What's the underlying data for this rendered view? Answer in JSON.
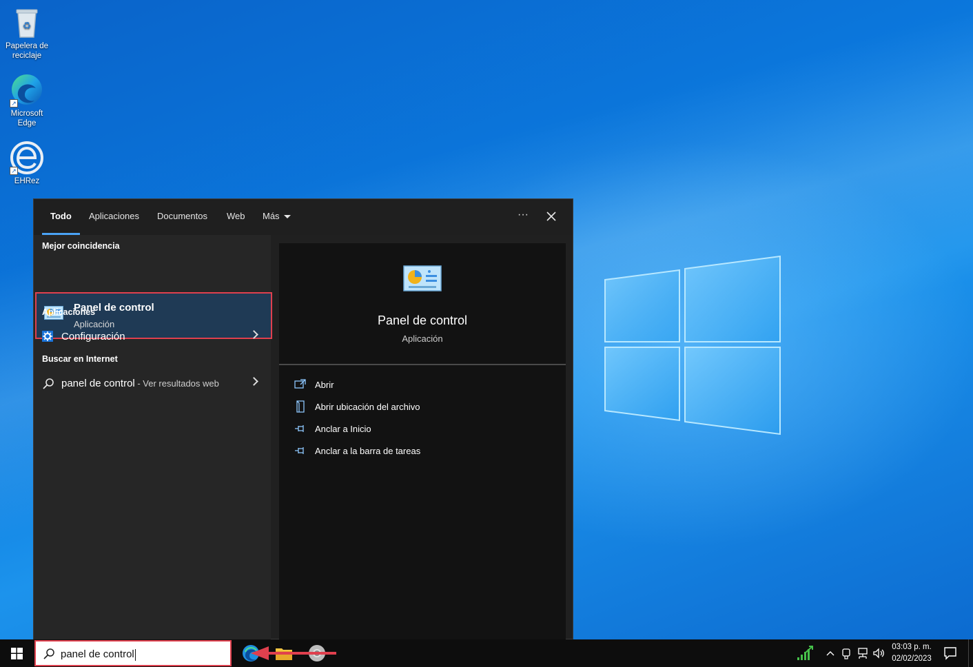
{
  "desktop": {
    "icons": [
      {
        "label_line1": "Papelera de",
        "label_line2": "reciclaje",
        "icon": "recycle-bin-icon"
      },
      {
        "label_line1": "Microsoft",
        "label_line2": "Edge",
        "icon": "edge-icon"
      },
      {
        "label_line1": "EHRez",
        "label_line2": "",
        "icon": "ehrez-icon"
      }
    ]
  },
  "search": {
    "tabs": [
      "Todo",
      "Aplicaciones",
      "Documentos",
      "Web",
      "Más"
    ],
    "active_tab": "Todo",
    "more_icon": "ellipsis-icon",
    "close_icon": "close-icon",
    "best_match_header": "Mejor coincidencia",
    "best_match": {
      "title": "Panel de control",
      "subtitle": "Aplicación",
      "icon": "control-panel-icon"
    },
    "apps_header": "Aplicaciones",
    "apps": [
      {
        "label": "Configuración",
        "icon": "settings-gear-icon"
      }
    ],
    "web_header": "Buscar en Internet",
    "web": [
      {
        "label": "panel de control",
        "suffix": " - Ver resultados web",
        "icon": "search-icon"
      }
    ],
    "preview": {
      "title": "Panel de control",
      "subtitle": "Aplicación",
      "actions": [
        {
          "label": "Abrir",
          "icon": "open-icon"
        },
        {
          "label": "Abrir ubicación del archivo",
          "icon": "file-location-icon"
        },
        {
          "label": "Anclar a Inicio",
          "icon": "pin-icon"
        },
        {
          "label": "Anclar a la barra de tareas",
          "icon": "pin-icon"
        }
      ]
    }
  },
  "taskbar": {
    "search_value": "panel de control",
    "clock_time": "03:03 p. m.",
    "clock_date": "02/02/2023",
    "accent_highlight": "#e0404e"
  }
}
